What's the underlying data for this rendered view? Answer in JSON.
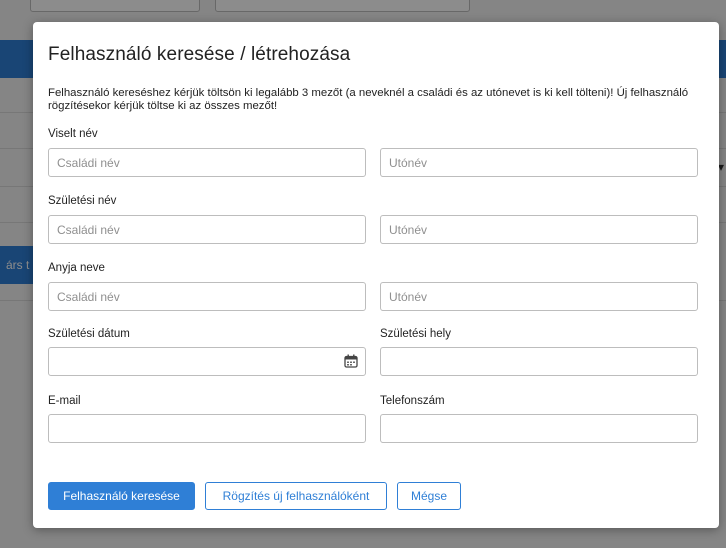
{
  "background": {
    "side_button_label": "árs t"
  },
  "modal": {
    "title": "Felhasználó keresése / létrehozása",
    "description": "Felhasználó kereséshez kérjük töltsön ki legalább 3 mezőt (a neveknél a családi és az utónevet is ki kell tölteni)! Új felhasználó rögzítésekor kérjük töltse ki az összes mezőt!",
    "fields": {
      "viselt_nev": {
        "label": "Viselt név",
        "family_placeholder": "Családi név",
        "given_placeholder": "Utónév"
      },
      "szuletesi_nev": {
        "label": "Születési név",
        "family_placeholder": "Családi név",
        "given_placeholder": "Utónév"
      },
      "anyja_neve": {
        "label": "Anyja neve",
        "family_placeholder": "Családi név",
        "given_placeholder": "Utónév"
      },
      "szuletesi_datum": {
        "label": "Születési dátum",
        "value": ""
      },
      "szuletesi_hely": {
        "label": "Születési hely",
        "value": ""
      },
      "email": {
        "label": "E-mail",
        "value": ""
      },
      "telefonszam": {
        "label": "Telefonszám",
        "value": ""
      }
    },
    "buttons": {
      "search": "Felhasználó keresése",
      "register_new": "Rögzítés új felhasználóként",
      "cancel": "Mégse"
    }
  },
  "colors": {
    "primary": "#2f7fd6",
    "border": "#bdbdbd",
    "overlay": "rgba(0,0,0,0.45)"
  },
  "icons": {
    "date_picker": "calendar-icon"
  }
}
